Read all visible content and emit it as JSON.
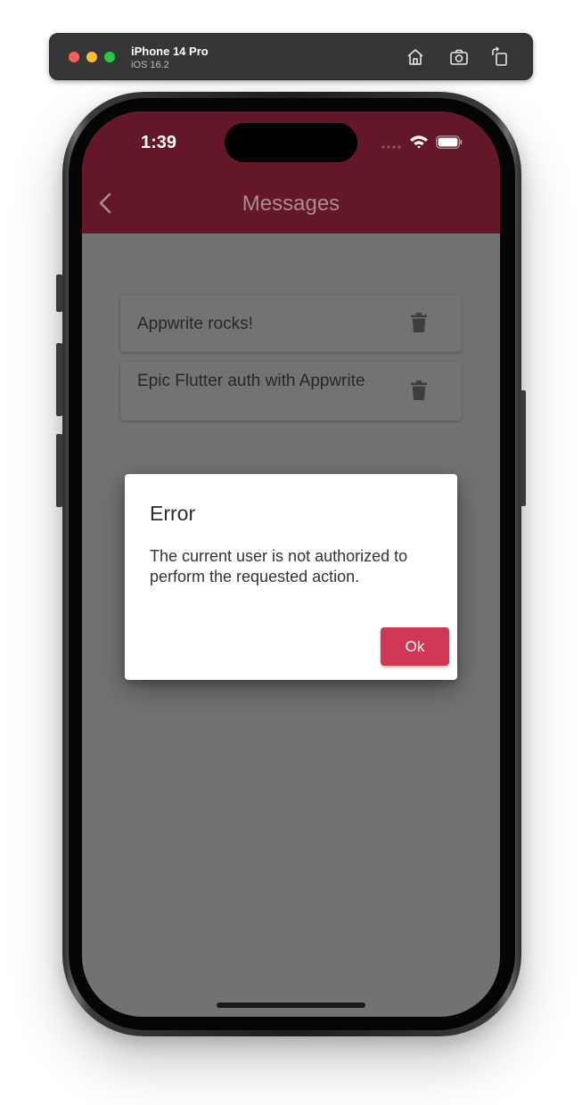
{
  "simulator": {
    "device_name": "iPhone 14 Pro",
    "os_version": "iOS 16.2",
    "buttons": [
      "home-icon",
      "screenshot-icon",
      "rotate-icon"
    ]
  },
  "status_bar": {
    "time": "1:39"
  },
  "app_bar": {
    "title": "Messages",
    "back_icon": "chevron-left-icon",
    "color": "#641726"
  },
  "messages": [
    {
      "text": "Appwrite rocks!",
      "delete_icon": "trash-icon"
    },
    {
      "text": "Epic Flutter auth with Appwrite",
      "delete_icon": "trash-icon"
    }
  ],
  "dialog": {
    "title": "Error",
    "body": "The current user is not authorized to perform the requested action.",
    "ok_label": "Ok",
    "accent": "#d13654"
  }
}
